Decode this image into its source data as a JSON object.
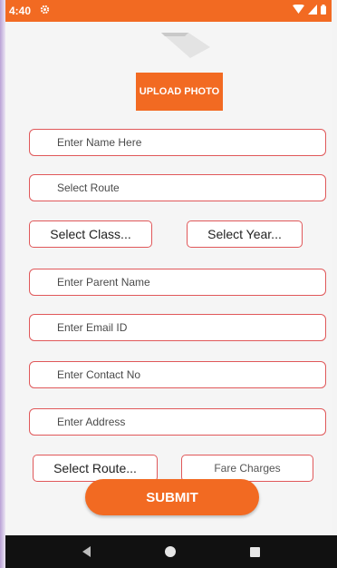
{
  "status_bar": {
    "time": "4:40",
    "settings_icon": "gear-icon",
    "wifi_icon": "wifi-icon",
    "signal_icon": "signal-icon",
    "battery_icon": "battery-icon",
    "color": "#f26a22"
  },
  "profile": {
    "photo_icon": "image-placeholder-icon",
    "upload_label": "UPLOAD PHOTO"
  },
  "form": {
    "name_placeholder": "Enter Name Here",
    "route_placeholder": "Select Route",
    "class_select": "Select Class...",
    "year_select": "Select Year...",
    "parent_placeholder": "Enter Parent Name",
    "email_placeholder": "Enter Email ID",
    "contact_placeholder": "Enter Contact No",
    "address_placeholder": "Enter Address",
    "route_select": "Select Route...",
    "fare_placeholder": "Fare Charges",
    "submit_label": "SUBMIT"
  },
  "nav_bar": {
    "back_icon": "back-triangle-icon",
    "home_icon": "home-circle-icon",
    "recents_icon": "recents-square-icon"
  },
  "colors": {
    "accent": "#f26a22",
    "field_border": "#e0585a",
    "background": "#f5f5f5"
  }
}
